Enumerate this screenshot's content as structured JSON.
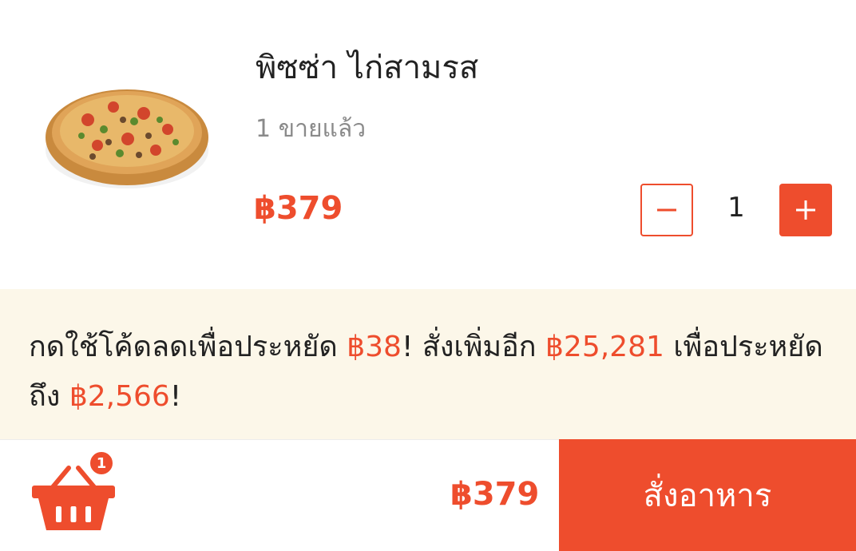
{
  "product": {
    "image_icon": "pizza-image",
    "name": "พิซซ่า ไก่สามรส",
    "sold": "1 ขายแล้ว",
    "price": "฿379",
    "quantity": "1",
    "minus_icon": "minus-icon",
    "plus_icon": "plus-icon"
  },
  "promo": {
    "part1": "กดใช้โค้ดลดเพื่อประหยัด ",
    "save_amount": "฿38",
    "part2": "! สั่งเพิ่มอีก ",
    "add_amount": "฿25,281",
    "part3": " เพื่อประหยัดถึง ",
    "max_save": "฿2,566",
    "part4": "!"
  },
  "bottom": {
    "cart_icon": "basket-icon",
    "cart_count": "1",
    "total": "฿379",
    "order_label": "สั่งอาหาร"
  },
  "colors": {
    "accent": "#ee4d2d",
    "promo_bg": "#fcf7e9",
    "text": "#222222",
    "muted": "#8a8a8a"
  }
}
